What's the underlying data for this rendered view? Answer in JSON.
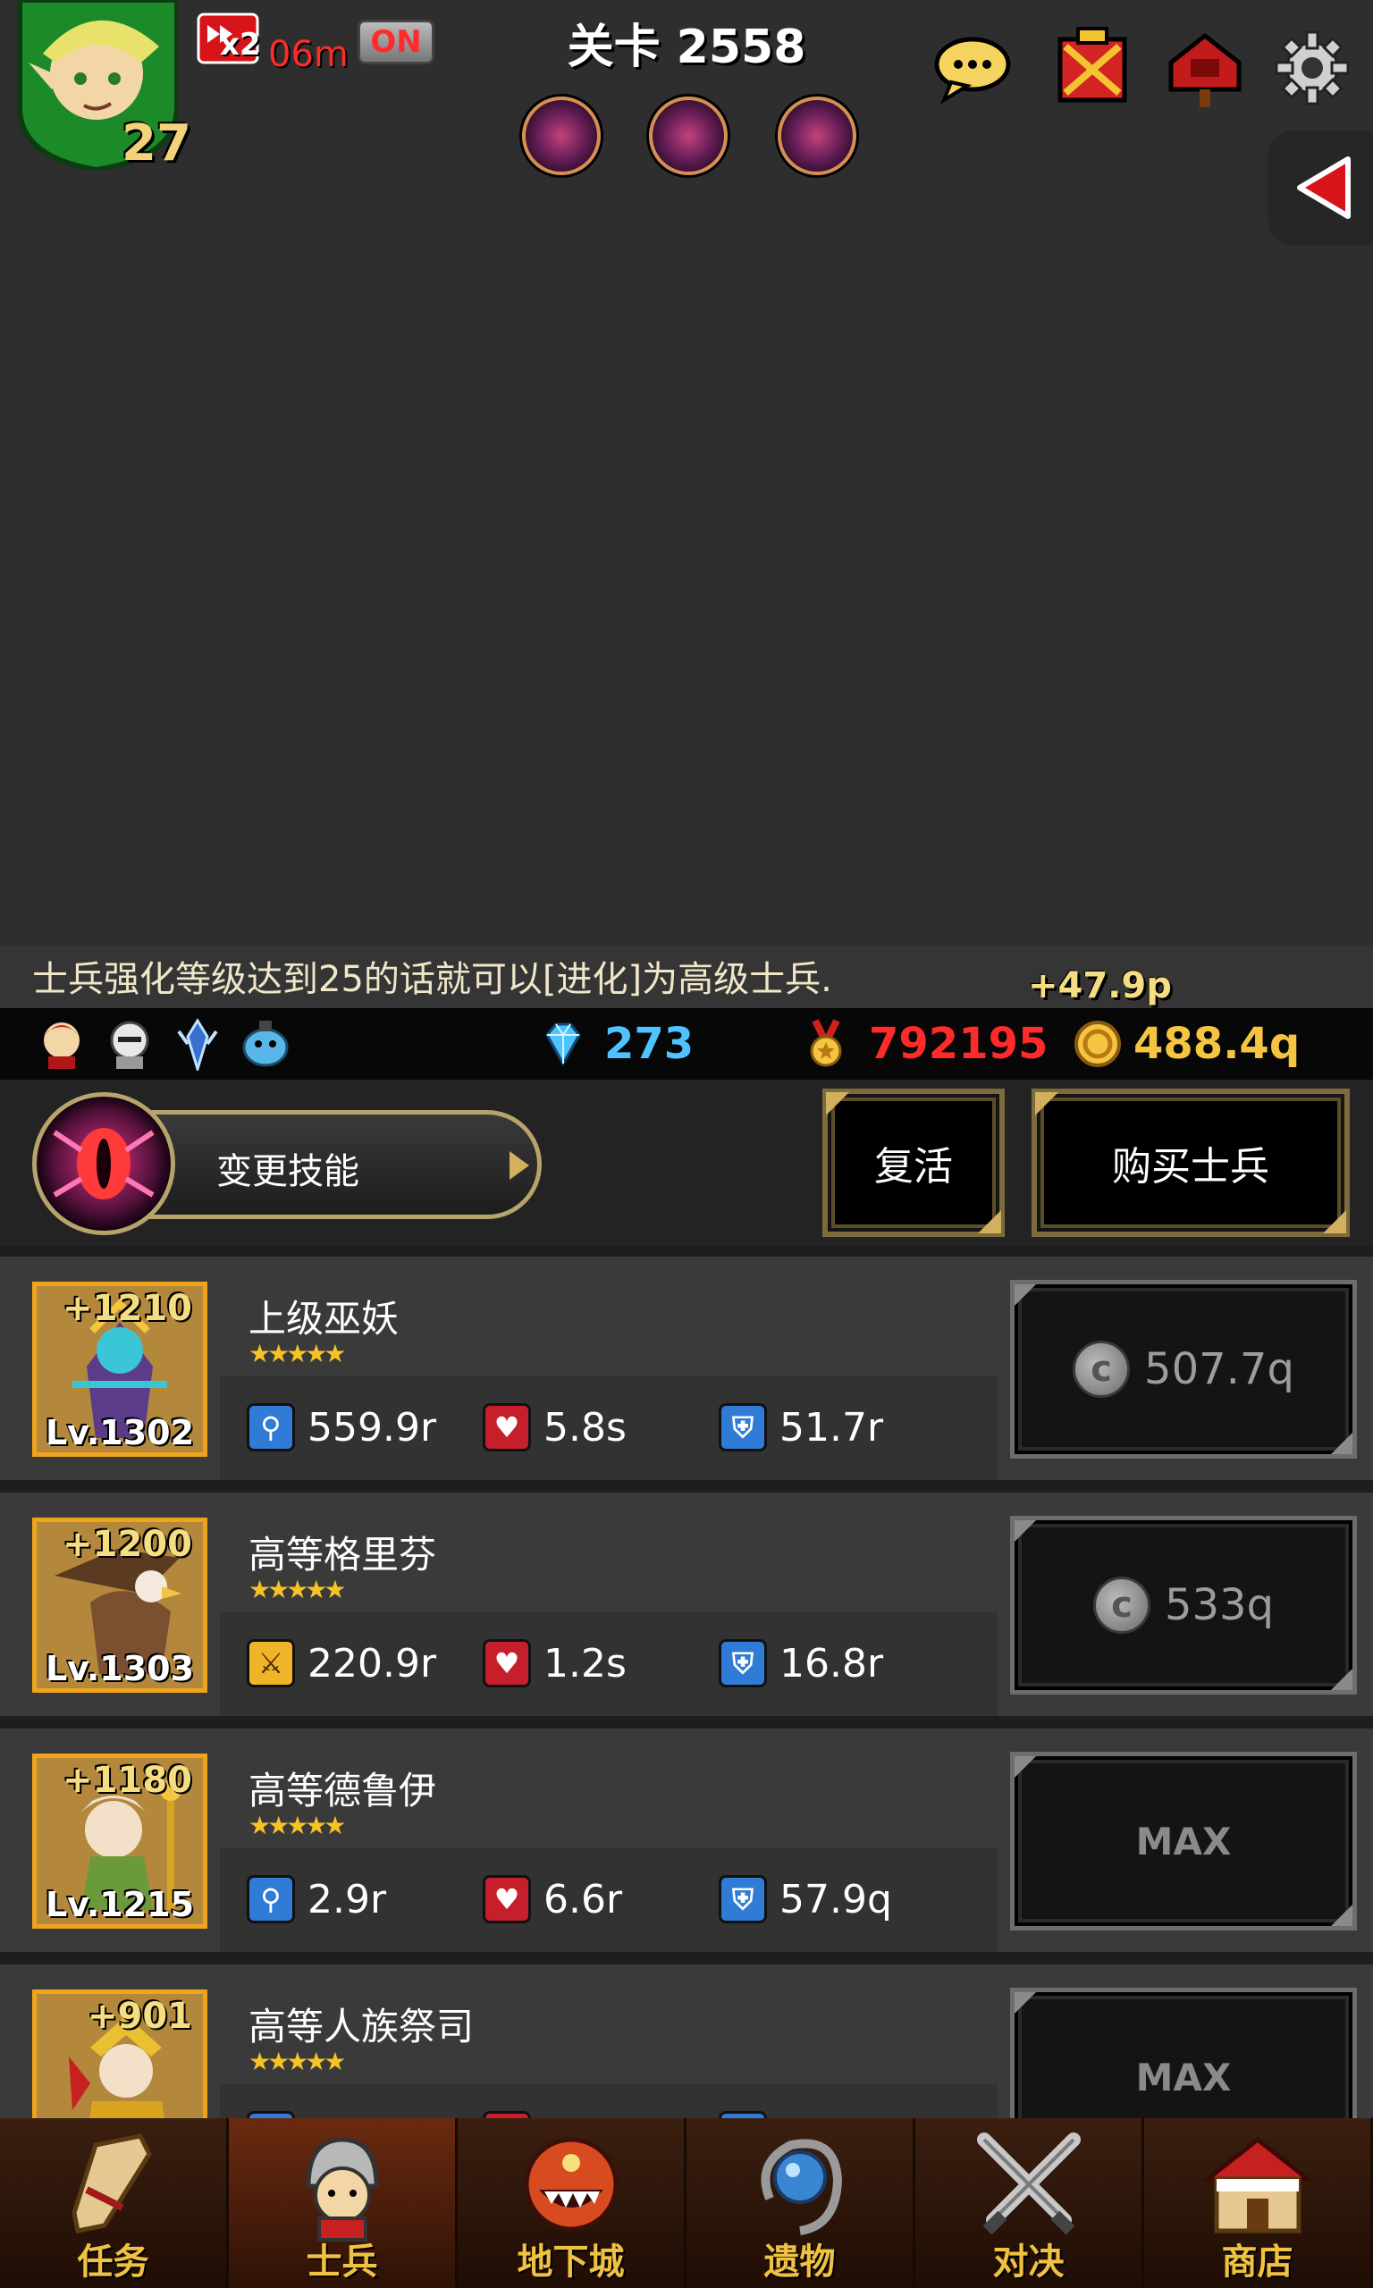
{
  "hud": {
    "player_level": "27",
    "speed_multiplier": "x2",
    "speed_remaining": "06m",
    "auto_toggle": "ON",
    "stage": "关卡 2558",
    "boss_icons": [
      "boss-portrait",
      "boss-portrait",
      "boss-portrait"
    ],
    "top_buttons": [
      "chat-icon",
      "guild-banner-icon",
      "mailbox-icon",
      "gear-icon"
    ],
    "side_toggle": "arrow-left-icon"
  },
  "hint": {
    "text": "士兵强化等级达到25的话就可以[进化]为高级士兵.",
    "gain": "+47.9p"
  },
  "party": [
    "red-hair-hero",
    "armored-knight",
    "blue-crystal-warrior",
    "blue-blob"
  ],
  "currency": {
    "gems": "273",
    "medals": "792195",
    "gold": "488.4q",
    "gem_color": "#4fc3ff",
    "medal_color": "#ff2a2a",
    "gold_color": "#f5c542"
  },
  "actions": {
    "change_skill": "变更技能",
    "revive": "复活",
    "buy_soldier": "购买士兵"
  },
  "soldiers": [
    {
      "name": "上级巫妖",
      "enhance": "+1210",
      "level": "Lv.1302",
      "stars": "★★★★★",
      "attack_icon": "magnifier-wand-icon",
      "attack": "559.9r",
      "hp": "5.8s",
      "defense": "51.7r",
      "cost": "507.7q",
      "maxed": false
    },
    {
      "name": "高等格里芬",
      "enhance": "+1200",
      "level": "Lv.1303",
      "stars": "★★★★★",
      "attack_icon": "sword-icon",
      "attack": "220.9r",
      "hp": "1.2s",
      "defense": "16.8r",
      "cost": "533q",
      "maxed": false
    },
    {
      "name": "高等德鲁伊",
      "enhance": "+1180",
      "level": "Lv.1215",
      "stars": "★★★★★",
      "attack_icon": "magnifier-wand-icon",
      "attack": "2.9r",
      "hp": "6.6r",
      "defense": "57.9q",
      "cost": "MAX",
      "maxed": true
    },
    {
      "name": "高等人族祭司",
      "enhance": "+901",
      "level": "",
      "stars": "★★★★★",
      "attack_icon": "magnifier-wand-icon",
      "attack": "",
      "hp": "",
      "defense": "",
      "cost": "MAX",
      "maxed": true
    }
  ],
  "nav": [
    {
      "label": "任务",
      "icon": "scroll-icon"
    },
    {
      "label": "士兵",
      "icon": "soldier-helmet-icon",
      "active": true
    },
    {
      "label": "地下城",
      "icon": "dungeon-monster-icon"
    },
    {
      "label": "遗物",
      "icon": "relic-orb-icon"
    },
    {
      "label": "对决",
      "icon": "crossed-swords-icon"
    },
    {
      "label": "商店",
      "icon": "shop-icon"
    }
  ]
}
